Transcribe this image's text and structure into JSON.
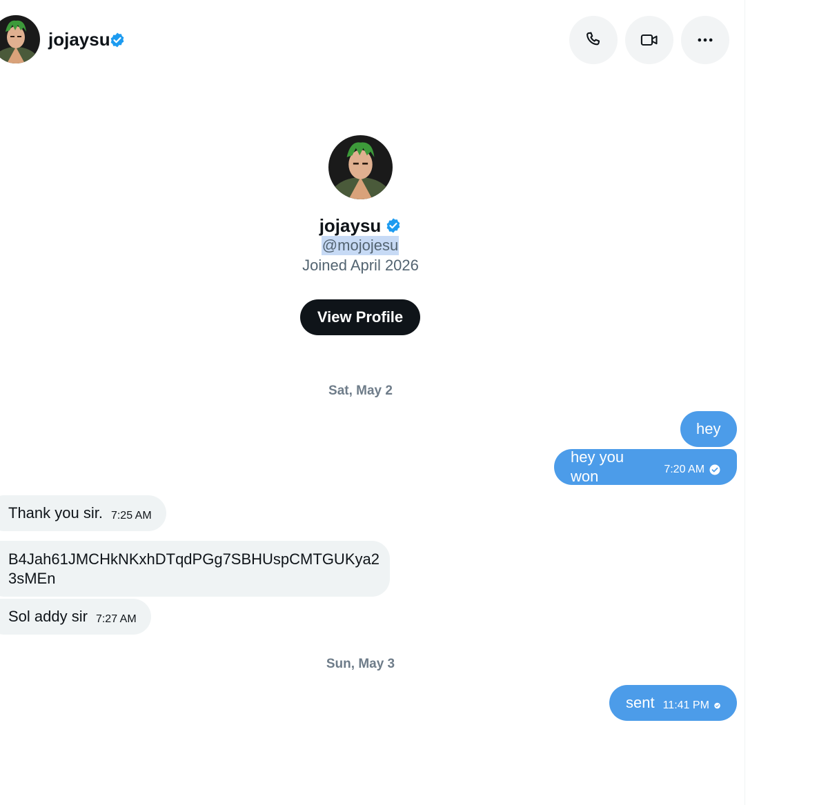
{
  "header": {
    "name": "jojaysu",
    "verified_icon": "verified-badge-icon",
    "actions": [
      {
        "name": "call-button",
        "icon": "phone-icon"
      },
      {
        "name": "video-call-button",
        "icon": "video-icon"
      },
      {
        "name": "more-options-button",
        "icon": "more-horizontal-icon"
      }
    ]
  },
  "profile": {
    "name": "jojaysu",
    "handle": "@mojojesu",
    "joined": "Joined April 2026",
    "view_profile_label": "View Profile"
  },
  "conversation": {
    "days": [
      {
        "label": "Sat, May 2",
        "messages": [
          {
            "direction": "outgoing",
            "text": "hey",
            "time": ""
          },
          {
            "direction": "outgoing",
            "text": "hey you won",
            "time": "7:20 AM",
            "read": true
          },
          {
            "direction": "incoming",
            "text": "Thank you sir.",
            "time": "7:25 AM"
          },
          {
            "direction": "incoming",
            "text": "B4Jah61JMCHkNKxhDTqdPGg7SBHUspCMTGUKya2 3sMEn",
            "text_lines": [
              "B4Jah61JMCHkNKxhDTqdPGg7SBHUspCMTGUKya2",
              "3sMEn"
            ],
            "time": ""
          },
          {
            "direction": "incoming",
            "text": "Sol addy sir",
            "time": "7:27 AM"
          }
        ]
      },
      {
        "label": "Sun, May 3",
        "messages": [
          {
            "direction": "outgoing",
            "text": "sent",
            "time": "11:41 PM",
            "read": true
          }
        ]
      }
    ]
  },
  "colors": {
    "accent": "#1d9bf0",
    "outgoing_bubble": "#4c9ce9",
    "incoming_bubble": "#eff3f4",
    "primary_text": "#0f1419",
    "secondary_text": "#536471",
    "handle_highlight": "#c7daf5"
  }
}
